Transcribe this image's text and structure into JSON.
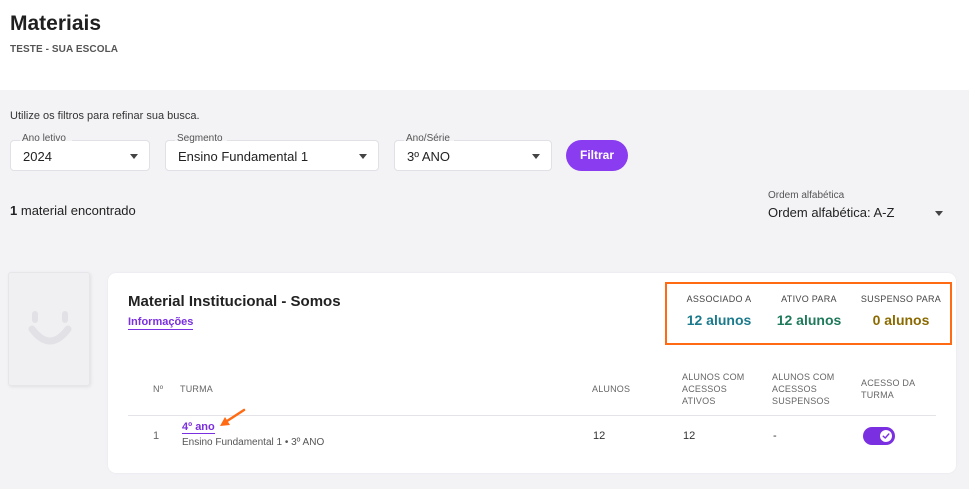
{
  "header": {
    "title": "Materiais",
    "subtitle": "TESTE - SUA ESCOLA"
  },
  "filters": {
    "hint": "Utilize os filtros para refinar sua busca.",
    "ano_letivo": {
      "label": "Ano letivo",
      "value": "2024"
    },
    "segmento": {
      "label": "Segmento",
      "value": "Ensino Fundamental 1"
    },
    "ano_serie": {
      "label": "Ano/Série",
      "value": "3º ANO"
    },
    "filter_button": "Filtrar"
  },
  "results": {
    "count": "1",
    "count_text": "material encontrado"
  },
  "sort": {
    "label": "Ordem alfabética",
    "value": "Ordem alfabética: A-Z"
  },
  "material": {
    "title": "Material Institucional - Somos",
    "info_link": "Informações",
    "stats": [
      {
        "label": "ASSOCIADO A",
        "value": "12 alunos",
        "color": "#1b7a8c"
      },
      {
        "label": "ATIVO PARA",
        "value": "12 alunos",
        "color": "#1f7a5a"
      },
      {
        "label": "SUSPENSO PARA",
        "value": "0 alunos",
        "color": "#8a6a00"
      }
    ],
    "table": {
      "headers": {
        "num": "Nº",
        "turma": "TURMA",
        "alunos": "ALUNOS",
        "ativos_1": "ALUNOS COM",
        "ativos_2": "ACESSOS",
        "ativos_3": "ATIVOS",
        "suspensos_1": "ALUNOS COM",
        "suspensos_2": "ACESSOS",
        "suspensos_3": "SUSPENSOS",
        "acesso_1": "ACESSO DA",
        "acesso_2": "TURMA"
      },
      "rows": [
        {
          "num": "1",
          "turma": "4º ano",
          "turma_sub": "Ensino Fundamental 1 • 3º ANO",
          "alunos": "12",
          "ativos": "12",
          "suspensos": "-",
          "acesso": true
        }
      ]
    }
  },
  "colors": {
    "accent": "#8a3cf0",
    "highlight_border": "#ff6a13",
    "background": "#f3f3f6"
  }
}
